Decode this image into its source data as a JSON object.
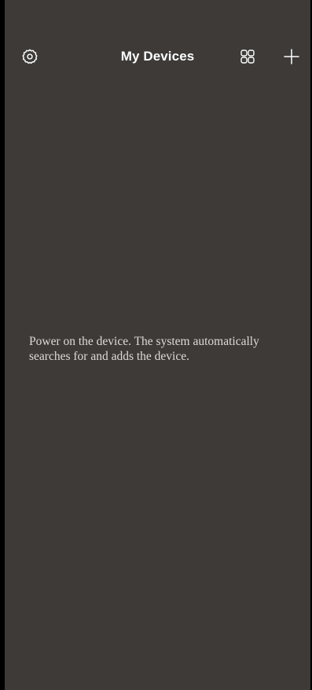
{
  "header": {
    "title": "My Devices",
    "left_icon": "settings-icon",
    "right_icons": [
      "grid-icon",
      "add-icon"
    ]
  },
  "main": {
    "empty_message": "Power on the device. The system automatically searches for and adds the device."
  },
  "colors": {
    "background": "#3d3a38",
    "frame": "#000000",
    "title": "#ffffff",
    "message": "#dedbd8"
  }
}
